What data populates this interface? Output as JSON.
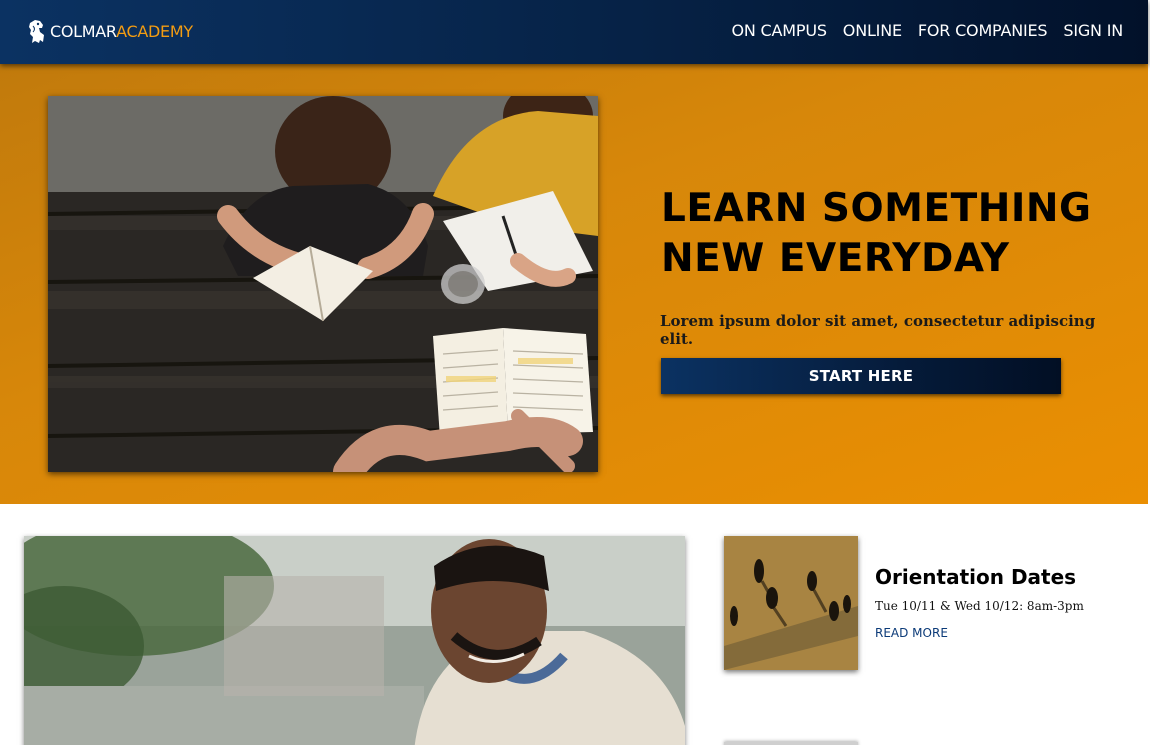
{
  "header": {
    "logo_icon": "lion-crest-icon",
    "brand_part1": "COLMAR",
    "brand_part2": "ACADEMY",
    "nav": [
      "ON CAMPUS",
      "ONLINE",
      "FOR COMPANIES",
      "SIGN IN"
    ]
  },
  "hero": {
    "title_line1": "LEARN SOMETHING",
    "title_line2": "NEW EVERYDAY",
    "subtitle": "Lorem ipsum dolor sit amet, consectetur adipiscing elit.",
    "cta_label": "START HERE"
  },
  "events": [
    {
      "title": "Orientation Dates",
      "date": "Tue 10/11 & Wed 10/12: 8am-3pm",
      "link_label": "READ MORE"
    }
  ],
  "colors": {
    "navy": "#062246",
    "orange": "#e38c05",
    "accent": "#f39c12",
    "link": "#0b3a78"
  }
}
